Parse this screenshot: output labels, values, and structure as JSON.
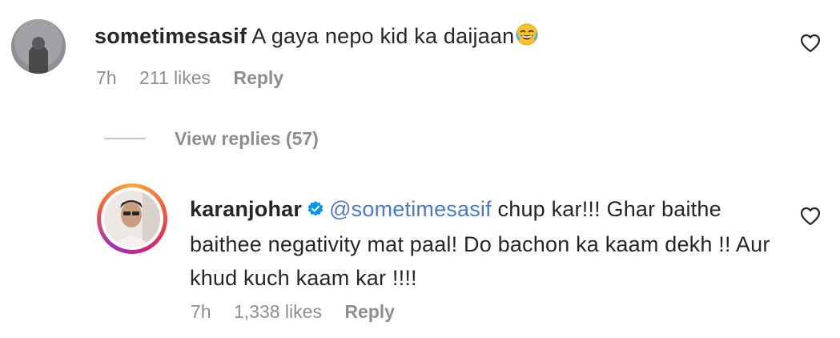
{
  "comments": [
    {
      "username": "sometimesasif",
      "text": "A gaya nepo kid ka daijaan",
      "emoji": "face-with-tears-of-joy",
      "time": "7h",
      "likes": "211 likes",
      "reply_label": "Reply",
      "view_replies": "View replies (57)"
    },
    {
      "username": "karanjohar",
      "verified": true,
      "mention": "@sometimesasif",
      "text": "chup kar!!! Ghar baithe baithee negativity mat paal! Do bachon ka kaam dekh !! Aur khud kuch kaam kar !!!!",
      "time": "7h",
      "likes": "1,338 likes",
      "reply_label": "Reply"
    }
  ],
  "colors": {
    "text": "#262626",
    "meta": "#8e8e8e",
    "mention": "#4b78c9",
    "verified": "#0095f6"
  }
}
